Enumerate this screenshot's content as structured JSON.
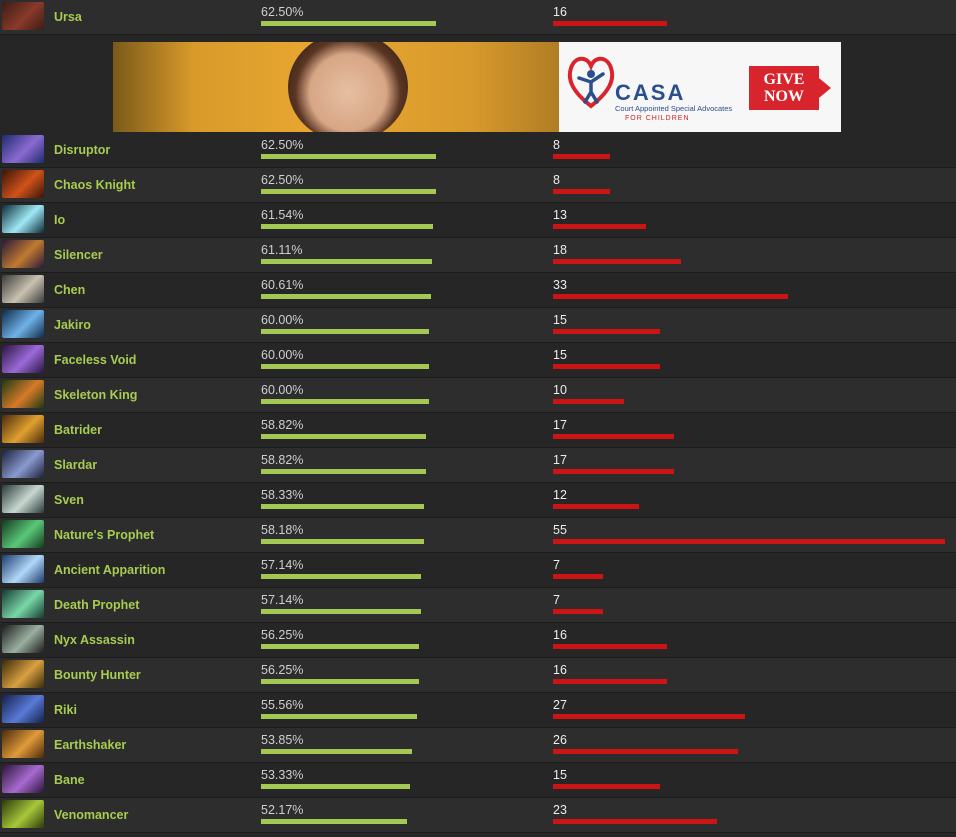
{
  "max_winrate": 62.5,
  "max_matches": 55,
  "colors": {
    "hero_name": "#a7cc50",
    "winrate_bar": "#a3c854",
    "matches_bar": "#cc1414",
    "background": "#262626"
  },
  "ad": {
    "brand": "CASA",
    "tagline": "Court Appointed Special Advocates",
    "tagline2": "FOR CHILDREN",
    "cta_line1": "GIVE",
    "cta_line2": "NOW"
  },
  "heroes": [
    {
      "name": "Ursa",
      "winrate": "62.50%",
      "winrate_value": 62.5,
      "matches": "16",
      "matches_value": 16,
      "icon": "ursa-portrait",
      "tint": [
        "#3b1c14",
        "#8a3a2a"
      ]
    },
    {
      "name": "Disruptor",
      "winrate": "62.50%",
      "winrate_value": 62.5,
      "matches": "8",
      "matches_value": 8,
      "icon": "disruptor-portrait",
      "tint": [
        "#1d2c6e",
        "#8a6ad0"
      ]
    },
    {
      "name": "Chaos Knight",
      "winrate": "62.50%",
      "winrate_value": 62.5,
      "matches": "8",
      "matches_value": 8,
      "icon": "chaos-knight-portrait",
      "tint": [
        "#3a1408",
        "#d0521a"
      ]
    },
    {
      "name": "Io",
      "winrate": "61.54%",
      "winrate_value": 61.54,
      "matches": "13",
      "matches_value": 13,
      "icon": "io-portrait",
      "tint": [
        "#0c2a36",
        "#9fe8f5"
      ]
    },
    {
      "name": "Silencer",
      "winrate": "61.11%",
      "winrate_value": 61.11,
      "matches": "18",
      "matches_value": 18,
      "icon": "silencer-portrait",
      "tint": [
        "#2a1838",
        "#c07a30"
      ]
    },
    {
      "name": "Chen",
      "winrate": "60.61%",
      "winrate_value": 60.61,
      "matches": "33",
      "matches_value": 33,
      "icon": "chen-portrait",
      "tint": [
        "#3a3a3a",
        "#c9c2b0"
      ]
    },
    {
      "name": "Jakiro",
      "winrate": "60.00%",
      "winrate_value": 60.0,
      "matches": "15",
      "matches_value": 15,
      "icon": "jakiro-portrait",
      "tint": [
        "#0e2a4a",
        "#6fb2e8"
      ]
    },
    {
      "name": "Faceless Void",
      "winrate": "60.00%",
      "winrate_value": 60.0,
      "matches": "15",
      "matches_value": 15,
      "icon": "faceless-void-portrait",
      "tint": [
        "#2a1440",
        "#9a6ad8"
      ]
    },
    {
      "name": "Skeleton King",
      "winrate": "60.00%",
      "winrate_value": 60.0,
      "matches": "10",
      "matches_value": 10,
      "icon": "skeleton-king-portrait",
      "tint": [
        "#1e3a14",
        "#d87a28"
      ]
    },
    {
      "name": "Batrider",
      "winrate": "58.82%",
      "winrate_value": 58.82,
      "matches": "17",
      "matches_value": 17,
      "icon": "batrider-portrait",
      "tint": [
        "#4a2a0a",
        "#e0a030"
      ]
    },
    {
      "name": "Slardar",
      "winrate": "58.82%",
      "winrate_value": 58.82,
      "matches": "17",
      "matches_value": 17,
      "icon": "slardar-portrait",
      "tint": [
        "#1a2038",
        "#8a9ad0"
      ]
    },
    {
      "name": "Sven",
      "winrate": "58.33%",
      "winrate_value": 58.33,
      "matches": "12",
      "matches_value": 12,
      "icon": "sven-portrait",
      "tint": [
        "#2a3a3a",
        "#c8d8d0"
      ]
    },
    {
      "name": "Nature's Prophet",
      "winrate": "58.18%",
      "winrate_value": 58.18,
      "matches": "55",
      "matches_value": 55,
      "icon": "natures-prophet-portrait",
      "tint": [
        "#143a1e",
        "#5ac878"
      ]
    },
    {
      "name": "Ancient Apparition",
      "winrate": "57.14%",
      "winrate_value": 57.14,
      "matches": "7",
      "matches_value": 7,
      "icon": "ancient-apparition-portrait",
      "tint": [
        "#1e3a6a",
        "#b0d8f8"
      ]
    },
    {
      "name": "Death Prophet",
      "winrate": "57.14%",
      "winrate_value": 57.14,
      "matches": "7",
      "matches_value": 7,
      "icon": "death-prophet-portrait",
      "tint": [
        "#143a30",
        "#7ad8a8"
      ]
    },
    {
      "name": "Nyx Assassin",
      "winrate": "56.25%",
      "winrate_value": 56.25,
      "matches": "16",
      "matches_value": 16,
      "icon": "nyx-assassin-portrait",
      "tint": [
        "#1a1a1a",
        "#9ab0a0"
      ]
    },
    {
      "name": "Bounty Hunter",
      "winrate": "56.25%",
      "winrate_value": 56.25,
      "matches": "16",
      "matches_value": 16,
      "icon": "bounty-hunter-portrait",
      "tint": [
        "#3a2a0a",
        "#d8a040"
      ]
    },
    {
      "name": "Riki",
      "winrate": "55.56%",
      "winrate_value": 55.56,
      "matches": "27",
      "matches_value": 27,
      "icon": "riki-portrait",
      "tint": [
        "#141e4a",
        "#5a7ad8"
      ]
    },
    {
      "name": "Earthshaker",
      "winrate": "53.85%",
      "winrate_value": 53.85,
      "matches": "26",
      "matches_value": 26,
      "icon": "earthshaker-portrait",
      "tint": [
        "#4a2a0a",
        "#e09a3a"
      ]
    },
    {
      "name": "Bane",
      "winrate": "53.33%",
      "winrate_value": 53.33,
      "matches": "15",
      "matches_value": 15,
      "icon": "bane-portrait",
      "tint": [
        "#2a1438",
        "#a86ad0"
      ]
    },
    {
      "name": "Venomancer",
      "winrate": "52.17%",
      "winrate_value": 52.17,
      "matches": "23",
      "matches_value": 23,
      "icon": "venomancer-portrait",
      "tint": [
        "#2a3a0a",
        "#a8c83a"
      ]
    }
  ]
}
